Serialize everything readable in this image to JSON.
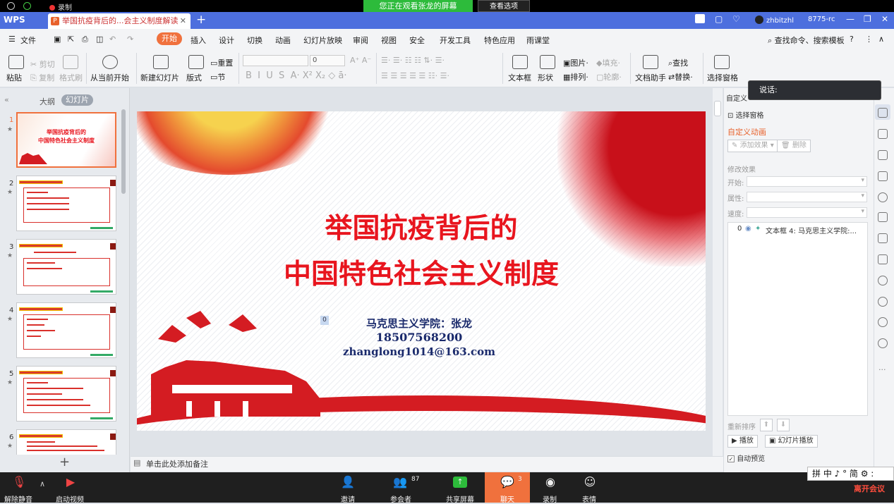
{
  "system": {
    "recording": "录制",
    "watching_banner": "您正在观看张龙的屏幕",
    "view_options": "查看选项"
  },
  "titlebar": {
    "app_name": "WPS",
    "doc_tab": "举国抗疫背后的...会主义制度解读",
    "new_tab": "+",
    "user": "zhbitzhl",
    "user_id": "8775-rc"
  },
  "menu": {
    "file": "文件",
    "items": [
      "开始",
      "插入",
      "设计",
      "切换",
      "动画",
      "幻灯片放映",
      "审阅",
      "视图",
      "安全",
      "开发工具",
      "特色应用",
      "雨课堂"
    ],
    "search": "查找命令、搜索模板"
  },
  "toolbar": {
    "paste": "粘贴",
    "cut": "剪切",
    "copy": "复制",
    "format_painter": "格式刷",
    "play_from_current": "从当前开始",
    "new_slide": "新建幻灯片",
    "layout": "版式",
    "reset": "重置",
    "section": "节",
    "font_size": "0",
    "textbox": "文本框",
    "shape": "形状",
    "picture": "图片",
    "fill": "填充",
    "arrange": "排列",
    "outline": "轮廓",
    "doc_assistant": "文档助手",
    "find": "查找",
    "replace": "替换",
    "selection_pane": "选择窗格"
  },
  "left": {
    "outline_tab": "大纲",
    "slides_tab": "幻灯片",
    "thumbs": [
      {
        "num": "1",
        "line1": "举国抗疫背后的",
        "line2": "中国特色社会主义制度"
      },
      {
        "num": "2"
      },
      {
        "num": "3"
      },
      {
        "num": "4"
      },
      {
        "num": "5"
      },
      {
        "num": "6"
      }
    ]
  },
  "slide": {
    "title1": "举国抗疫背后的",
    "title2": "中国特色社会主义制度",
    "author": "马克思主义学院：张龙",
    "phone": "18507568200",
    "email": "zhanglong1014@163.com",
    "anim_tag": "0"
  },
  "notes": {
    "placeholder": "单击此处添加备注"
  },
  "right_panel": {
    "header": "自定义",
    "selection_pane": "选择窗格",
    "custom_anim": "自定义动画",
    "add_effect": "添加效果",
    "delete": "删除",
    "modify": "修改效果",
    "start": "开始:",
    "property": "属性:",
    "speed": "速度:",
    "anim_item_index": "0",
    "anim_item": "文本框 4: 马克思主义学院:...",
    "reorder": "重新排序",
    "play": "播放",
    "slideshow": "幻灯片播放",
    "auto_preview": "自动预览"
  },
  "tooltip": {
    "text": "说话:"
  },
  "meeting": {
    "mute": "解除静音",
    "video": "启动视频",
    "invite": "邀请",
    "participants": "参会者",
    "participants_count": "87",
    "share": "共享屏幕",
    "chat": "聊天",
    "chat_count": "3",
    "record": "录制",
    "reactions": "表情",
    "leave": "离开会议",
    "ime": "拼 中 ♪ ° 简 ⚙ :"
  },
  "colors": {
    "accent": "#f0713d",
    "titlebar": "#4d6fde",
    "slide_red": "#e8151e",
    "share_green": "#2dbb3b"
  }
}
